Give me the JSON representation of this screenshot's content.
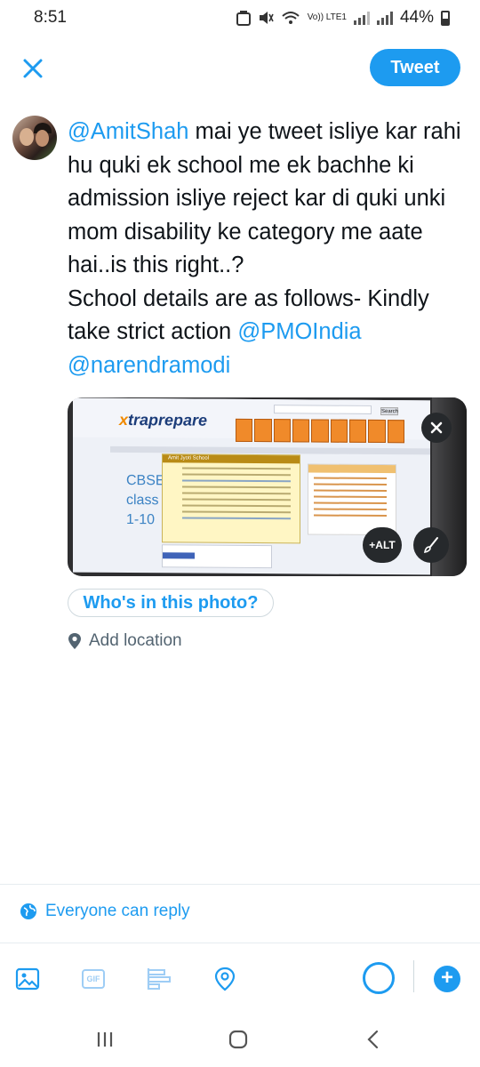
{
  "status_bar": {
    "time": "8:51",
    "network_label": "Vo)) LTE1",
    "battery": "44%",
    "icons": [
      "notification-icon",
      "mute-icon",
      "wifi-icon",
      "signal-icon",
      "battery-icon"
    ]
  },
  "header": {
    "close_icon": "close-icon",
    "tweet_label": "Tweet"
  },
  "tweet": {
    "mention_1": "@AmitShah",
    "text_1": " mai ye tweet isliye kar rahi hu quki ek school me ek bachhe ki admission isliye reject kar di quki unki mom disability ke category me aate hai..is this right..?",
    "text_2": "School details are as follows- Kindly take strict action ",
    "mention_2": "@PMOIndia",
    "mention_3": "@narendramodi"
  },
  "media": {
    "alt_label": "+ALT",
    "close_icon": "close-icon",
    "edit_icon": "brush-icon",
    "screenshot_text": {
      "logo_prefix": "x",
      "logo_text": "traprepare",
      "search_btn": "Search",
      "cbse_lines": [
        "CBSE",
        "class",
        "1-10"
      ],
      "card_title": "Amit Jyoti School"
    }
  },
  "who_in_photo": "Who's in this photo?",
  "location_label": "Add location",
  "reply_setting": "Everyone can reply",
  "toolbar": {
    "gif_label": "GIF",
    "add_icon": "+",
    "icons": [
      "image-icon",
      "gif-icon",
      "poll-icon",
      "location-icon"
    ]
  },
  "colors": {
    "accent": "#1d9bf0",
    "text": "#0f1419",
    "muted": "#536471"
  }
}
